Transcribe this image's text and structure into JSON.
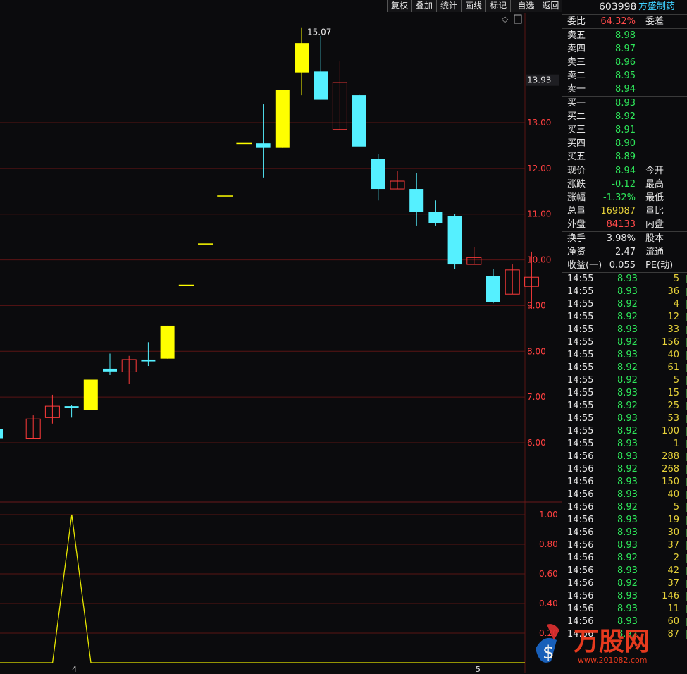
{
  "toolbar": [
    "复权",
    "叠加",
    "统计",
    "画线",
    "标记",
    "-自选",
    "返回"
  ],
  "stock": {
    "code": "603998",
    "name": "方盛制药"
  },
  "order_ratio": {
    "label": "委比",
    "value": "64.32%",
    "diff_label": "委差"
  },
  "sell": [
    {
      "label": "卖五",
      "price": "8.98"
    },
    {
      "label": "卖四",
      "price": "8.97"
    },
    {
      "label": "卖三",
      "price": "8.96"
    },
    {
      "label": "卖二",
      "price": "8.95"
    },
    {
      "label": "卖一",
      "price": "8.94"
    }
  ],
  "buy": [
    {
      "label": "买一",
      "price": "8.93"
    },
    {
      "label": "买二",
      "price": "8.92"
    },
    {
      "label": "买三",
      "price": "8.91"
    },
    {
      "label": "买四",
      "price": "8.90"
    },
    {
      "label": "买五",
      "price": "8.89"
    }
  ],
  "quote": [
    {
      "label": "现价",
      "value": "8.94",
      "color": "green",
      "label2": "今开"
    },
    {
      "label": "涨跌",
      "value": "-0.12",
      "color": "green",
      "label2": "最高"
    },
    {
      "label": "涨幅",
      "value": "-1.32%",
      "color": "green",
      "label2": "最低"
    },
    {
      "label": "总量",
      "value": "169087",
      "color": "yellow",
      "label2": "量比"
    },
    {
      "label": "外盘",
      "value": "84133",
      "color": "red",
      "label2": "内盘"
    }
  ],
  "fundamentals": [
    {
      "label": "换手",
      "value": "3.98%",
      "label2": "股本"
    },
    {
      "label": "净资",
      "value": "2.47",
      "label2": "流通"
    },
    {
      "label": "收益(一)",
      "value": "0.055",
      "label2": "PE(动)"
    }
  ],
  "ticks": [
    {
      "t": "14:55",
      "p": "8.93",
      "v": "5"
    },
    {
      "t": "14:55",
      "p": "8.93",
      "v": "36"
    },
    {
      "t": "14:55",
      "p": "8.92",
      "v": "4"
    },
    {
      "t": "14:55",
      "p": "8.92",
      "v": "12"
    },
    {
      "t": "14:55",
      "p": "8.93",
      "v": "33"
    },
    {
      "t": "14:55",
      "p": "8.92",
      "v": "156"
    },
    {
      "t": "14:55",
      "p": "8.93",
      "v": "40"
    },
    {
      "t": "14:55",
      "p": "8.92",
      "v": "61"
    },
    {
      "t": "14:55",
      "p": "8.92",
      "v": "5"
    },
    {
      "t": "14:55",
      "p": "8.93",
      "v": "15"
    },
    {
      "t": "14:55",
      "p": "8.92",
      "v": "25"
    },
    {
      "t": "14:55",
      "p": "8.93",
      "v": "53"
    },
    {
      "t": "14:55",
      "p": "8.92",
      "v": "100"
    },
    {
      "t": "14:55",
      "p": "8.93",
      "v": "1"
    },
    {
      "t": "14:56",
      "p": "8.93",
      "v": "288"
    },
    {
      "t": "14:56",
      "p": "8.92",
      "v": "268"
    },
    {
      "t": "14:56",
      "p": "8.93",
      "v": "150"
    },
    {
      "t": "14:56",
      "p": "8.93",
      "v": "40"
    },
    {
      "t": "14:56",
      "p": "8.92",
      "v": "5"
    },
    {
      "t": "14:56",
      "p": "8.93",
      "v": "19"
    },
    {
      "t": "14:56",
      "p": "8.93",
      "v": "30"
    },
    {
      "t": "14:56",
      "p": "8.93",
      "v": "37"
    },
    {
      "t": "14:56",
      "p": "8.92",
      "v": "2"
    },
    {
      "t": "14:56",
      "p": "8.93",
      "v": "42"
    },
    {
      "t": "14:56",
      "p": "8.92",
      "v": "37"
    },
    {
      "t": "14:56",
      "p": "8.93",
      "v": "146"
    },
    {
      "t": "14:56",
      "p": "8.93",
      "v": "11"
    },
    {
      "t": "14:56",
      "p": "8.93",
      "v": "60"
    },
    {
      "t": "14:56",
      "p": "8.92",
      "v": "87"
    }
  ],
  "colors": {
    "up": "#ff3b3b",
    "down": "#55f0ff",
    "limit_up": "#ffff00",
    "grid": "#5a1414",
    "axis": "#ff4040",
    "indicator": "#e6e600"
  },
  "watermark": {
    "brand": "万股网",
    "url": "www.201082.com"
  },
  "chart_data": [
    {
      "type": "candlestick",
      "title": "",
      "price_label": "13.93",
      "max_label": "15.07",
      "yticks": [
        "6.00",
        "7.00",
        "8.00",
        "9.00",
        "10.00",
        "11.00",
        "12.00",
        "13.00"
      ],
      "ylim": [
        5.2,
        15.6
      ],
      "xtick_labels": [
        "4",
        "5"
      ],
      "candles": [
        {
          "o": 6.3,
          "c": 6.1,
          "h": 6.3,
          "l": 6.08,
          "kind": "down"
        },
        {
          "o": 6.1,
          "c": 6.52,
          "h": 6.6,
          "l": 6.1,
          "kind": "up"
        },
        {
          "o": 6.55,
          "c": 6.8,
          "h": 7.05,
          "l": 6.42,
          "kind": "up"
        },
        {
          "o": 6.8,
          "c": 6.76,
          "h": 6.82,
          "l": 6.55,
          "kind": "down"
        },
        {
          "o": 6.72,
          "c": 7.38,
          "h": 7.38,
          "l": 6.72,
          "kind": "limit"
        },
        {
          "o": 7.62,
          "c": 7.56,
          "h": 7.95,
          "l": 7.48,
          "kind": "down"
        },
        {
          "o": 7.55,
          "c": 7.82,
          "h": 7.9,
          "l": 7.28,
          "kind": "up"
        },
        {
          "o": 7.82,
          "c": 7.78,
          "h": 8.2,
          "l": 7.68,
          "kind": "down"
        },
        {
          "o": 7.84,
          "c": 8.56,
          "h": 8.56,
          "l": 7.84,
          "kind": "limit"
        },
        {
          "o": 9.45,
          "c": 9.45,
          "h": 9.45,
          "l": 9.45,
          "kind": "line"
        },
        {
          "o": 10.35,
          "c": 10.35,
          "h": 10.35,
          "l": 10.35,
          "kind": "line"
        },
        {
          "o": 11.4,
          "c": 11.4,
          "h": 11.4,
          "l": 11.4,
          "kind": "line"
        },
        {
          "o": 12.55,
          "c": 12.55,
          "h": 12.55,
          "l": 12.55,
          "kind": "line"
        },
        {
          "o": 12.55,
          "c": 12.45,
          "h": 13.4,
          "l": 11.8,
          "kind": "down"
        },
        {
          "o": 12.45,
          "c": 13.72,
          "h": 13.72,
          "l": 12.45,
          "kind": "limit"
        },
        {
          "o": 14.1,
          "c": 14.74,
          "h": 15.07,
          "l": 13.6,
          "kind": "limit"
        },
        {
          "o": 14.12,
          "c": 13.5,
          "h": 14.9,
          "l": 13.5,
          "kind": "down"
        },
        {
          "o": 12.85,
          "c": 13.88,
          "h": 14.34,
          "l": 12.85,
          "kind": "up"
        },
        {
          "o": 13.6,
          "c": 12.48,
          "h": 13.63,
          "l": 12.48,
          "kind": "down"
        },
        {
          "o": 12.2,
          "c": 11.55,
          "h": 12.32,
          "l": 11.3,
          "kind": "down"
        },
        {
          "o": 11.55,
          "c": 11.72,
          "h": 11.95,
          "l": 11.55,
          "kind": "up"
        },
        {
          "o": 11.55,
          "c": 11.05,
          "h": 11.9,
          "l": 10.75,
          "kind": "down"
        },
        {
          "o": 11.05,
          "c": 10.8,
          "h": 11.3,
          "l": 10.75,
          "kind": "down"
        },
        {
          "o": 10.95,
          "c": 9.9,
          "h": 11.0,
          "l": 9.8,
          "kind": "down"
        },
        {
          "o": 9.9,
          "c": 10.05,
          "h": 10.28,
          "l": 9.9,
          "kind": "up"
        },
        {
          "o": 9.65,
          "c": 9.07,
          "h": 9.8,
          "l": 9.05,
          "kind": "down"
        },
        {
          "o": 9.25,
          "c": 9.78,
          "h": 9.9,
          "l": 9.25,
          "kind": "up"
        },
        {
          "o": 9.42,
          "c": 9.62,
          "h": 10.18,
          "l": 8.93,
          "kind": "up"
        }
      ]
    },
    {
      "type": "line",
      "title": "",
      "yticks": [
        "0.20",
        "0.40",
        "0.60",
        "0.80",
        "1.00"
      ],
      "ylim": [
        0,
        1.05
      ],
      "values": [
        0,
        0,
        0,
        0,
        1,
        0,
        0,
        0,
        0,
        0,
        0,
        0,
        0,
        0,
        0,
        0,
        0,
        0,
        0,
        0,
        0,
        0,
        0,
        0,
        0,
        0,
        0,
        0
      ]
    }
  ]
}
